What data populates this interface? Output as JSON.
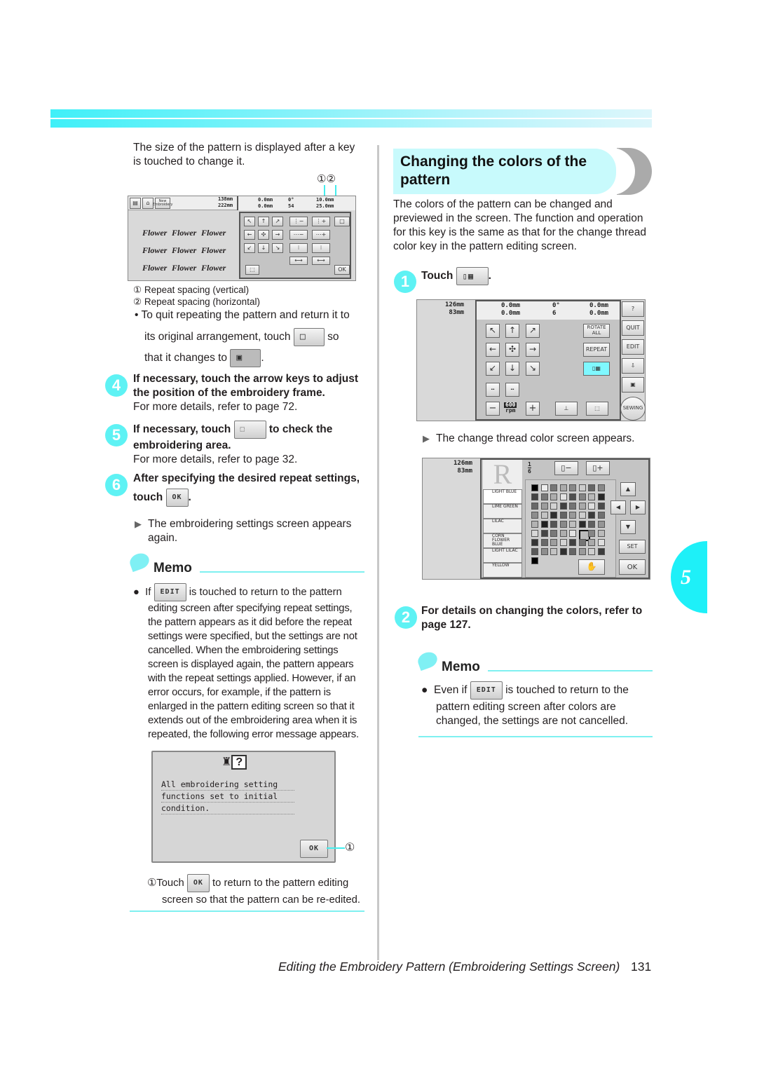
{
  "colors": {
    "accent": "#3ff0f8",
    "heading_bg": "#c8fafc",
    "text": "#231f20",
    "highlight": "#7ff8ff"
  },
  "left": {
    "intro": "The size of the pattern is displayed after a key is touched to change it.",
    "callouts": [
      "①",
      "②"
    ],
    "screen1": {
      "new_label": "New Embroidery",
      "height": "138mm",
      "width": "222mm",
      "v_pos": "0.0mm",
      "h_pos": "0.0mm",
      "angle": "0°",
      "colors": "54",
      "v_spacing": "10.0mm",
      "h_spacing": "25.0mm",
      "pattern_word": "Flower",
      "ok": "OK"
    },
    "legend": [
      "① Repeat spacing (vertical)",
      "② Repeat spacing (horizontal)"
    ],
    "bullet_a": "To quit repeating the pattern and return it to",
    "bullet_b": "its original arrangement, touch",
    "bullet_c": "so",
    "bullet_d": "that it changes to",
    "bullet_e": ".",
    "step4": {
      "num": "4",
      "title": "If necessary, touch the arrow keys to adjust the position of the embroidery frame.",
      "detail": "For more details, refer to page 72."
    },
    "step5": {
      "num": "5",
      "title_a": "If necessary, touch",
      "title_b": "to check the",
      "title_c": "embroidering area.",
      "detail": "For more details, refer to page 32."
    },
    "step6": {
      "num": "6",
      "title": "After specifying the desired repeat settings,",
      "touch": "touch",
      "ok": "OK",
      "end": "."
    },
    "result": "The embroidering settings screen appears again.",
    "memo": {
      "title": "Memo",
      "if": "If",
      "edit": "EDIT",
      "rest": "is touched to return to the pattern",
      "body": "editing screen after specifying repeat settings, the pattern appears as it did before the repeat settings were specified, but the settings are not cancelled. When the embroidering settings screen is displayed again, the pattern appears with the repeat settings applied. However, if an error occurs, for example, if the pattern is enlarged in the pattern editing screen so that it extends out of the embroidering area when it is repeated, the following error message appears."
    },
    "error_dialog": {
      "lines": [
        "All embroidering setting",
        "functions set to initial",
        "condition."
      ],
      "ok": "OK",
      "callout": "①"
    },
    "caption_a": "①Touch",
    "caption_ok": "OK",
    "caption_b": "to return to the pattern editing",
    "caption_c": "screen so that the pattern can be re-edited."
  },
  "right": {
    "heading": "Changing the colors of the pattern",
    "intro": "The colors of the pattern can be changed and previewed in the screen. The function and operation for this key is the same as that for the change thread color key in the pattern editing screen.",
    "step1": {
      "num": "1",
      "touch": "Touch",
      "end": "."
    },
    "screen2": {
      "height": "126mm",
      "width": "83mm",
      "v_pos": "0.0mm",
      "h_pos": "0.0mm",
      "angle": "0°",
      "colors": "6",
      "v_sp": "0.0mm",
      "h_sp": "0.0mm",
      "rotate_all": "ROTATE ALL",
      "repeat": "REPEAT",
      "quit": "QUIT",
      "edit": "EDIT",
      "sewing": "SEWING",
      "speed": "600",
      "rpm": "rpm",
      "minus": "−",
      "plus": "+"
    },
    "result": "The change thread color screen appears.",
    "screen3": {
      "height": "126mm",
      "width": "83mm",
      "fraction_num": "1",
      "fraction_den": "6",
      "threads": [
        "LIGHT BLUE",
        "LIME GREEN",
        "LILAC",
        "CORN FLOWER BLUE",
        "LIGHT LILAC",
        "YELLOW"
      ],
      "set": "SET",
      "ok": "OK"
    },
    "step2": {
      "num": "2",
      "title": "For details on changing the colors, refer to page 127."
    },
    "memo": {
      "title": "Memo",
      "even": "Even if",
      "edit": "EDIT",
      "rest": "is touched to return to the",
      "body": "pattern editing screen after colors are changed, the settings are not cancelled."
    }
  },
  "chapter_tab": "5",
  "footer": {
    "title": "Editing the Embroidery Pattern (Embroidering Settings Screen)",
    "page": "131"
  }
}
